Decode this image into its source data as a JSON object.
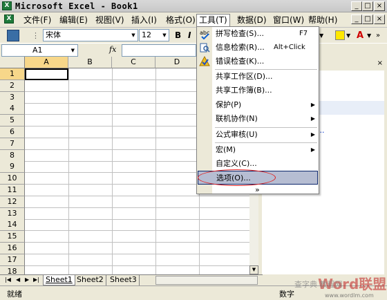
{
  "title": "Microsoft Excel - Book1",
  "menubar": {
    "file": "文件(F)",
    "edit": "编辑(E)",
    "view": "视图(V)",
    "insert": "插入(I)",
    "format": "格式(O)",
    "tools": "工具(T)",
    "data": "数据(D)",
    "window": "窗口(W)",
    "help": "帮助(H)"
  },
  "toolbar": {
    "font": "宋体",
    "size": "12",
    "bold": "B",
    "italic": "I",
    "fontcolor": "A"
  },
  "formula": {
    "namebox": "A1",
    "fx": "fx"
  },
  "columns": [
    "A",
    "B",
    "C",
    "D"
  ],
  "rows": [
    "1",
    "2",
    "3",
    "4",
    "5",
    "6",
    "7",
    "8",
    "9",
    "10",
    "11",
    "12",
    "13",
    "14",
    "15",
    "16",
    "17",
    "18"
  ],
  "sheets": [
    "Sheet1",
    "Sheet2",
    "Sheet3"
  ],
  "status": {
    "ready": "就绪",
    "mode": "数字"
  },
  "tools_menu": [
    {
      "label": "拼写检查(S)...",
      "shortcut": "F7"
    },
    {
      "label": "信息检索(R)...",
      "shortcut": "Alt+Click"
    },
    {
      "label": "错误检查(K)..."
    },
    {
      "label": "共享工作区(D)..."
    },
    {
      "label": "共享工作簿(B)..."
    },
    {
      "label": "保护(P)"
    },
    {
      "label": "联机协作(N)"
    },
    {
      "label": "公式审核(U)"
    },
    {
      "label": "宏(M)"
    },
    {
      "label": "自定义(C)..."
    },
    {
      "label": "选项(O)..."
    }
  ],
  "expand": "»",
  "taskpane_hint": "...",
  "watermark": {
    "line1": "Word联盟",
    "line2": "www.wordlm.com",
    "line3": "查字典 教程网"
  },
  "colors": {
    "accent": "#0a246a",
    "highlight": "#b6bdd2",
    "circle": "#e02020"
  }
}
